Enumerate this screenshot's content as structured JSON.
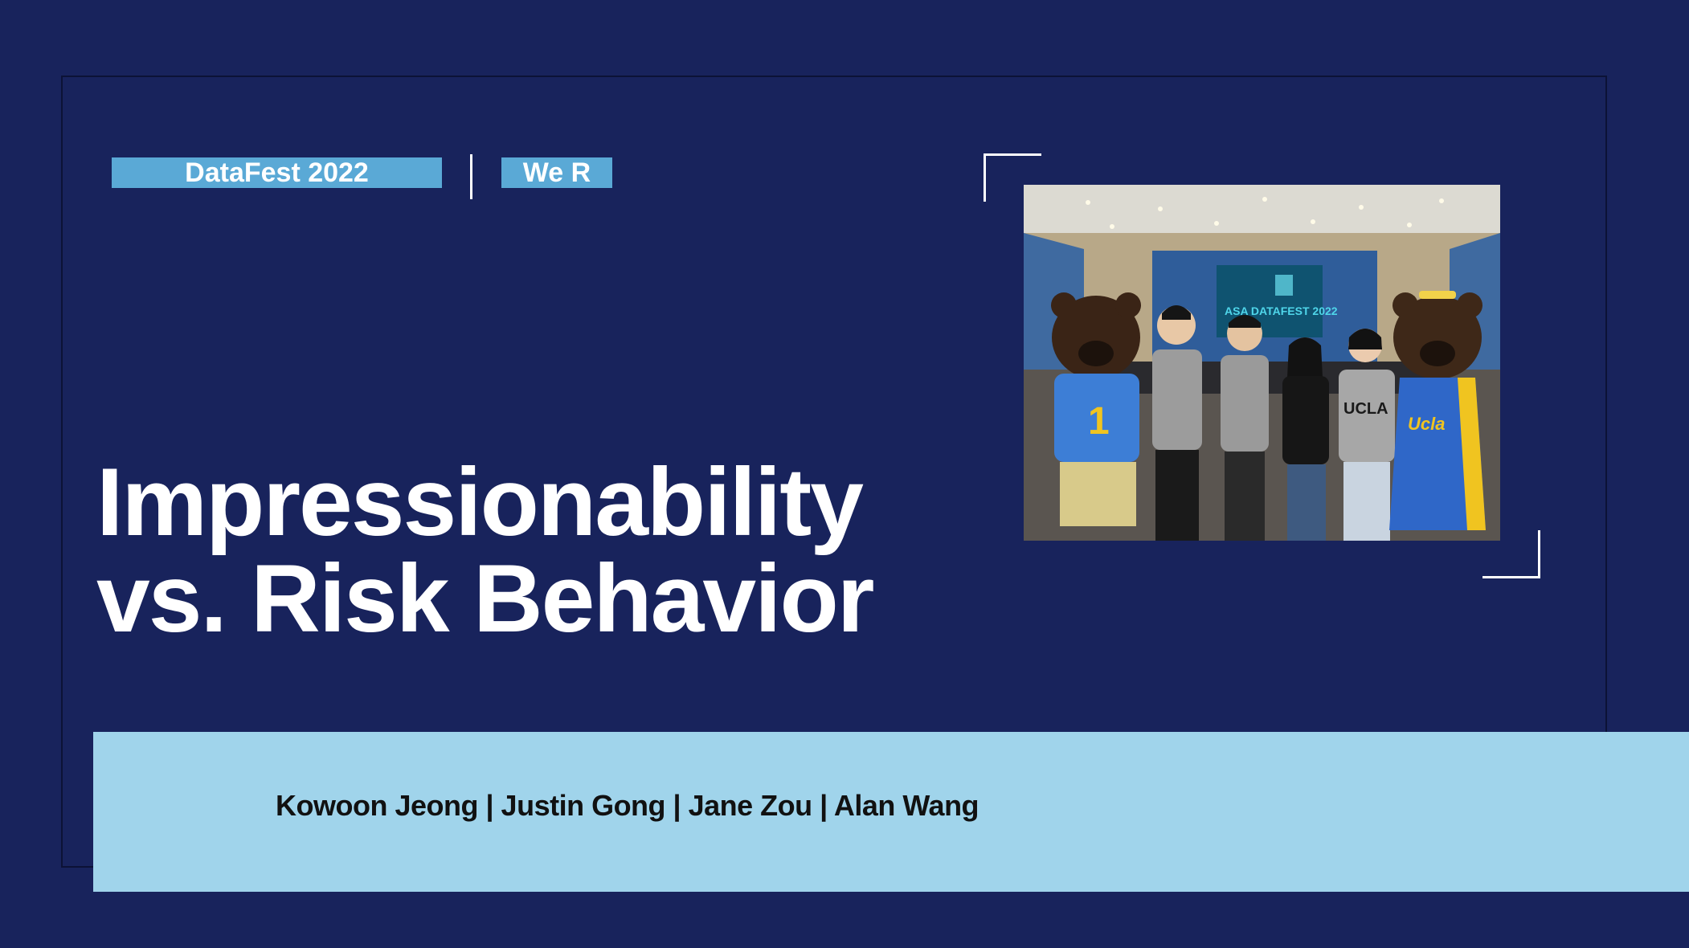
{
  "slide": {
    "tags": {
      "event": "DataFest 2022",
      "team": "We R"
    },
    "title": {
      "line1": "Impressionability",
      "line2": "vs. Risk Behavior"
    },
    "authors": "Kowoon Jeong | Justin Gong | Jane Zou | Alan Wang",
    "photo": {
      "screen_line1": "ASA DATAFEST 2022",
      "jersey_number": "1",
      "hoodie_text": "UCLA",
      "dress_text": "Ucla"
    }
  },
  "colors": {
    "background": "#18235c",
    "tag_fill": "#5aa9d6",
    "band_fill": "#a0d4eb",
    "title_text": "#ffffff"
  }
}
